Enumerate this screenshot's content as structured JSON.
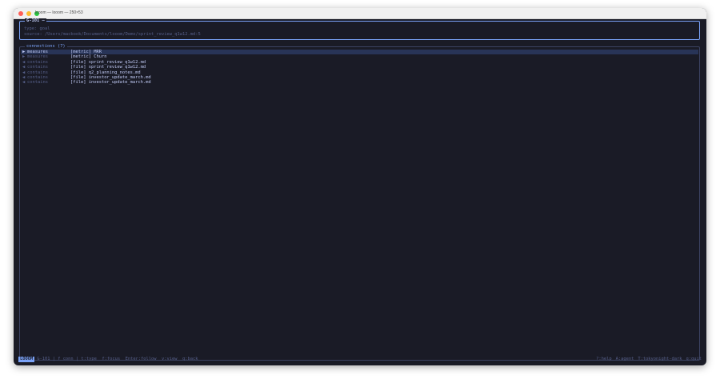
{
  "window": {
    "title": "looom — looom — 250×53"
  },
  "node": {
    "id": "G-101 —",
    "type_line": "type: goal",
    "source_line": "source: /Users/macbook/Documents/looom/Demo/sprint_review_q1w12.md:5"
  },
  "connections": {
    "title": "connections (7)",
    "rows": [
      {
        "arrow": "▶",
        "relation": "measures",
        "target": "[metric] MRR"
      },
      {
        "arrow": "▶",
        "relation": "measures",
        "target": "[metric] Churn"
      },
      {
        "arrow": "◀",
        "relation": "contains",
        "target": "[file] sprint_review_q1w12.md"
      },
      {
        "arrow": "◀",
        "relation": "contains",
        "target": "[file] sprint_review_q1w12.md"
      },
      {
        "arrow": "◀",
        "relation": "contains",
        "target": "[file] q2_planning_notes.md"
      },
      {
        "arrow": "◀",
        "relation": "contains",
        "target": "[file] investor_update_march.md"
      },
      {
        "arrow": "◀",
        "relation": "contains",
        "target": "[file] investor_update_march.md"
      }
    ]
  },
  "status": {
    "mode": "LOOOM",
    "crumbs": "G-101 | f conn | t:type  f:focus  Enter:follow  v:view  q:back",
    "help": "?:help",
    "agent": "A:agent",
    "theme": "T:tokyonight-dark",
    "quit": "q:quit"
  },
  "colors": {
    "background": "#1a1b26",
    "accent": "#7aa2f7",
    "selection": "#283457",
    "muted": "#565f89",
    "foreground": "#c0caf5"
  }
}
